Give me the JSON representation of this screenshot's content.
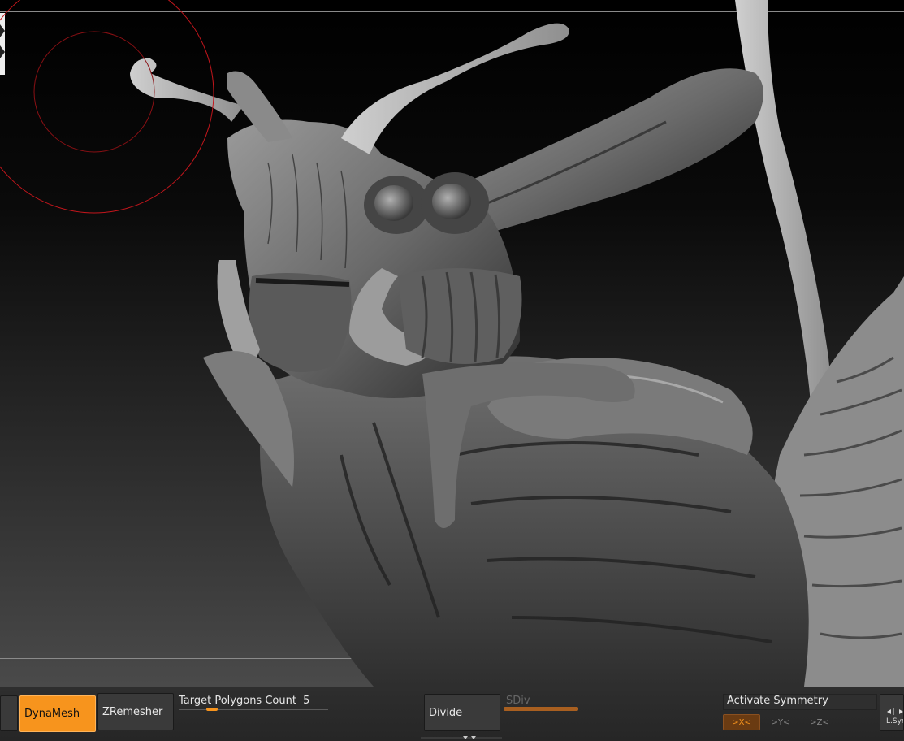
{
  "viewport": {
    "subject": "sculpted-creature-mesh",
    "brush_color": "#c4161c"
  },
  "toolbar": {
    "dynamesh_label": "DynaMesh",
    "zremesher_label": "ZRemesher",
    "target_polygons_label": "Target Polygons Count",
    "target_polygons_value": "5",
    "target_polygons_fraction": 0.2,
    "divide_label": "Divide",
    "sdiv_label": "SDiv",
    "accent_color": "#f7941d"
  },
  "symmetry": {
    "header": "Activate Symmetry",
    "x_label": ">X<",
    "y_label": ">Y<",
    "z_label": ">Z<",
    "x_active": true
  },
  "edge": {
    "lsym_label": "L.Sym"
  }
}
